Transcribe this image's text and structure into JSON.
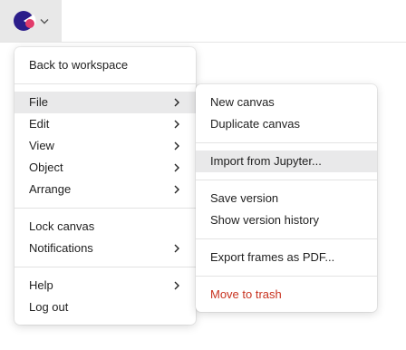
{
  "topbar": {
    "logo_icon": "app-logo-icon",
    "dropdown_icon": "chevron-down-icon",
    "logo_colors": {
      "dark": "#2b1d8a",
      "accent": "#e13b6b"
    }
  },
  "main_menu": {
    "back": "Back to workspace",
    "file": "File",
    "edit": "Edit",
    "view": "View",
    "object": "Object",
    "arrange": "Arrange",
    "lock": "Lock canvas",
    "notifications": "Notifications",
    "help": "Help",
    "logout": "Log out"
  },
  "file_submenu": {
    "new_canvas": "New canvas",
    "duplicate_canvas": "Duplicate canvas",
    "import_jupyter": "Import from Jupyter...",
    "save_version": "Save version",
    "show_history": "Show version history",
    "export_pdf": "Export frames as PDF...",
    "move_to_trash": "Move to trash"
  },
  "colors": {
    "highlight": "#e9e9ea",
    "danger": "#c8321f"
  }
}
